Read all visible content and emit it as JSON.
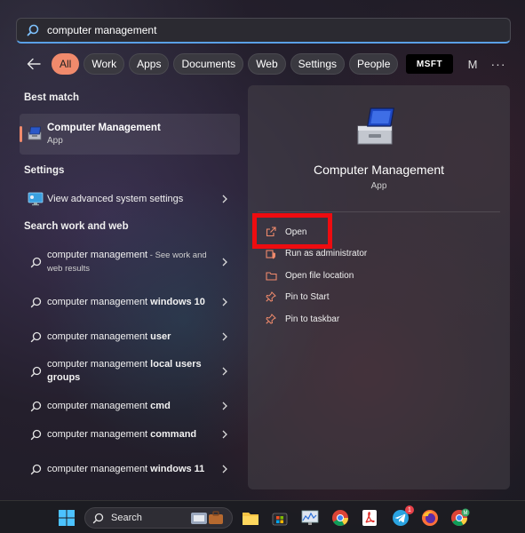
{
  "search": {
    "query": "computer management"
  },
  "filters": [
    "All",
    "Work",
    "Apps",
    "Documents",
    "Web",
    "Settings",
    "People"
  ],
  "filters_active": "All",
  "header_extras": {
    "msft_label": "MSFT",
    "avatar_letter": "M",
    "more": "···"
  },
  "sections": {
    "best_match": "Best match",
    "settings": "Settings",
    "search_web": "Search work and web"
  },
  "best_match": {
    "name": "Computer Management",
    "type": "App"
  },
  "settings_items": [
    {
      "label": "View advanced system settings"
    }
  ],
  "web_results": [
    {
      "base": "computer management",
      "bold": "",
      "hint": " - See work and web results"
    },
    {
      "base": "computer management ",
      "bold": "windows 10",
      "hint": ""
    },
    {
      "base": "computer management ",
      "bold": "user",
      "hint": ""
    },
    {
      "base": "computer management ",
      "bold": "local users groups",
      "hint": ""
    },
    {
      "base": "computer management ",
      "bold": "cmd",
      "hint": ""
    },
    {
      "base": "computer management ",
      "bold": "command",
      "hint": ""
    },
    {
      "base": "computer management ",
      "bold": "windows 11",
      "hint": ""
    }
  ],
  "detail": {
    "title": "Computer Management",
    "type": "App",
    "actions": [
      {
        "label": "Open",
        "icon": "open-external-icon"
      },
      {
        "label": "Run as administrator",
        "icon": "shield-admin-icon"
      },
      {
        "label": "Open file location",
        "icon": "folder-icon"
      },
      {
        "label": "Pin to Start",
        "icon": "pin-icon"
      },
      {
        "label": "Pin to taskbar",
        "icon": "pin-icon"
      }
    ]
  },
  "taskbar": {
    "search_label": "Search",
    "telegram_badge": "1"
  },
  "colors": {
    "accent": "#f08a6c",
    "highlight_box": "#ee0c10",
    "search_focus": "#5aa0e6"
  }
}
